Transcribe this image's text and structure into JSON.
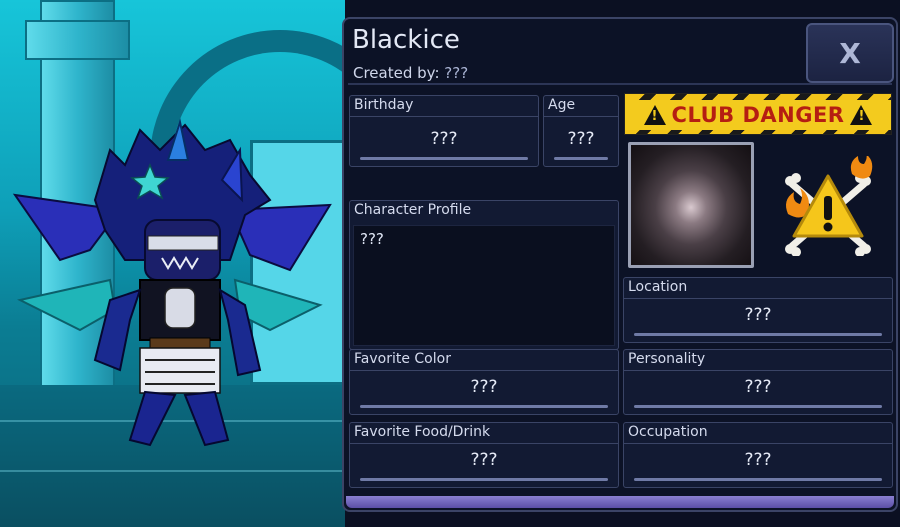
{
  "character": {
    "name": "Blackice",
    "created_by_label": "Created by:",
    "created_by_value": "???"
  },
  "close_button": {
    "label": "X"
  },
  "fields": {
    "birthday": {
      "label": "Birthday",
      "value": "???"
    },
    "age": {
      "label": "Age",
      "value": "???"
    },
    "profile": {
      "label": "Character Profile",
      "value": "???"
    },
    "location": {
      "label": "Location",
      "value": "???"
    },
    "favorite_color": {
      "label": "Favorite Color",
      "value": "???"
    },
    "personality": {
      "label": "Personality",
      "value": "???"
    },
    "favorite_food": {
      "label": "Favorite Food/Drink",
      "value": "???"
    },
    "occupation": {
      "label": "Occupation",
      "value": "???"
    }
  },
  "club_banner": {
    "text": "CLUB DANGER"
  },
  "icons": {
    "club_icon": "skull-crossbones-warning-icon",
    "close": "close-icon"
  },
  "colors": {
    "panel_bg": "#0c1226",
    "banner_yellow": "#f3cb1e",
    "banner_text": "#b51e12",
    "scene_cyan": "#17c5d9"
  }
}
